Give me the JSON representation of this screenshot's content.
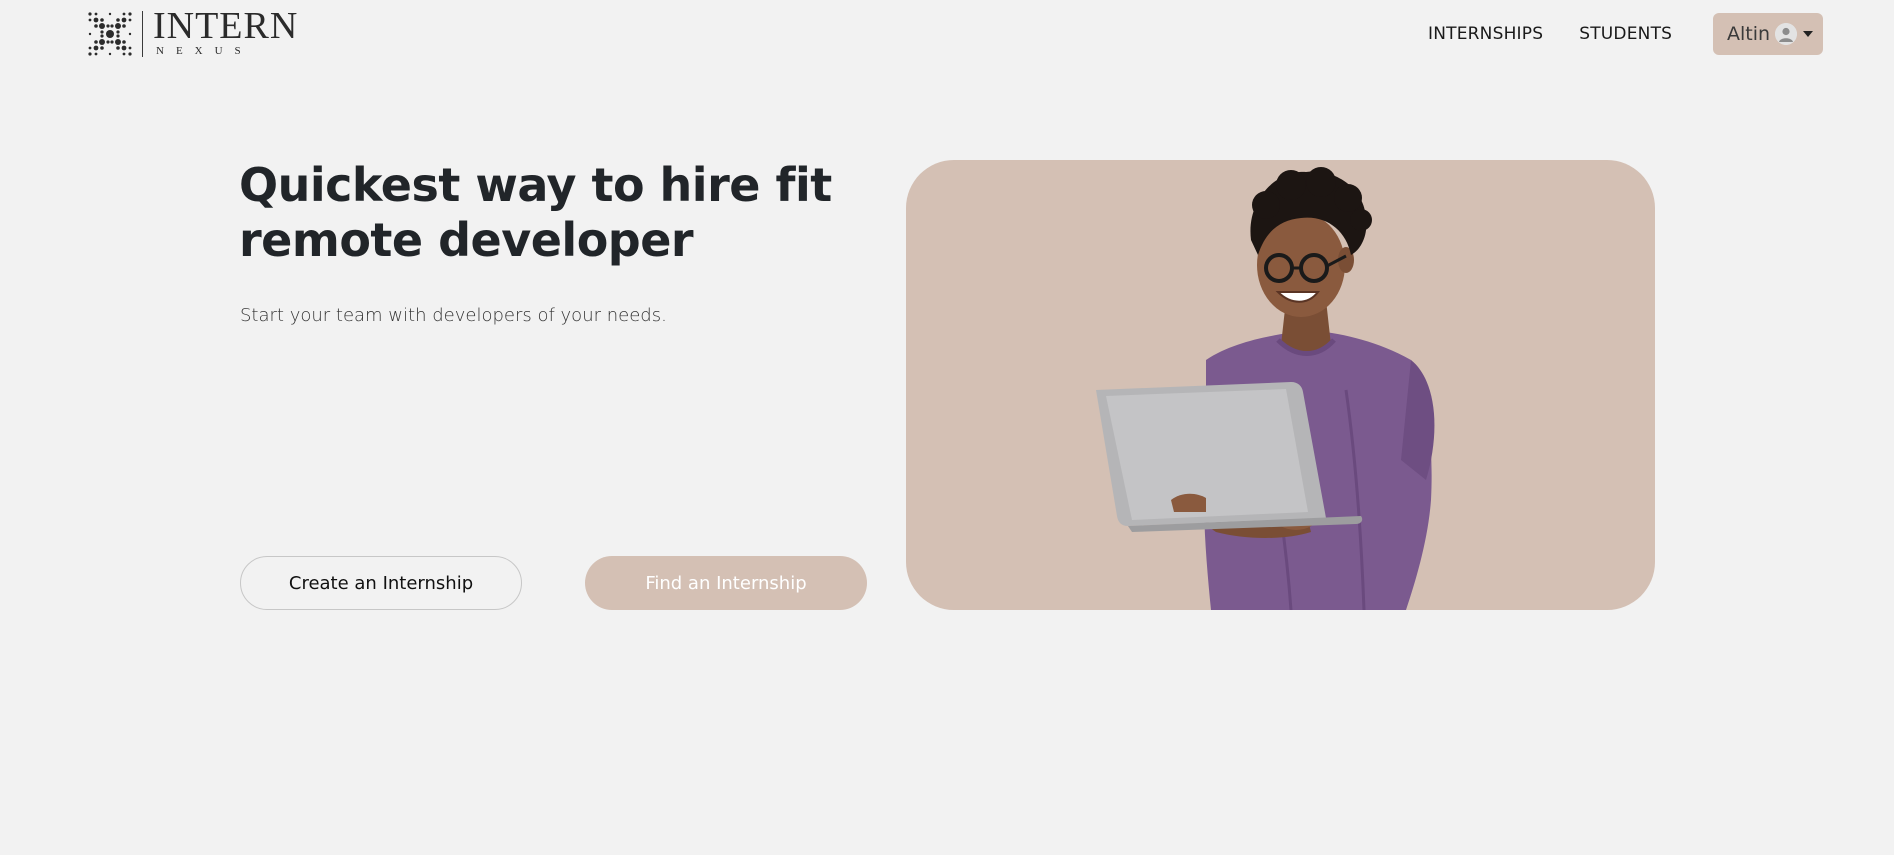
{
  "brand": {
    "logo_title": "INTERN",
    "logo_subtitle": "NEXUS",
    "logo_icon": "x-dots-logo-icon"
  },
  "nav": {
    "links": [
      {
        "label": "INTERNSHIPS"
      },
      {
        "label": "STUDENTS"
      }
    ],
    "user": {
      "name": "Altin",
      "avatar_icon": "user-avatar-icon",
      "dropdown_icon": "caret-down-icon"
    }
  },
  "hero": {
    "title": "Quickest way to hire fit remote developer",
    "subtitle": "Start your team with developers of your needs.",
    "primary_button": "Create an Internship",
    "secondary_button": "Find an Internship",
    "image_subject": "young-man-with-laptop-photo"
  },
  "colors": {
    "background": "#f2f2f2",
    "accent": "#d4c0b4",
    "text": "#212529"
  }
}
